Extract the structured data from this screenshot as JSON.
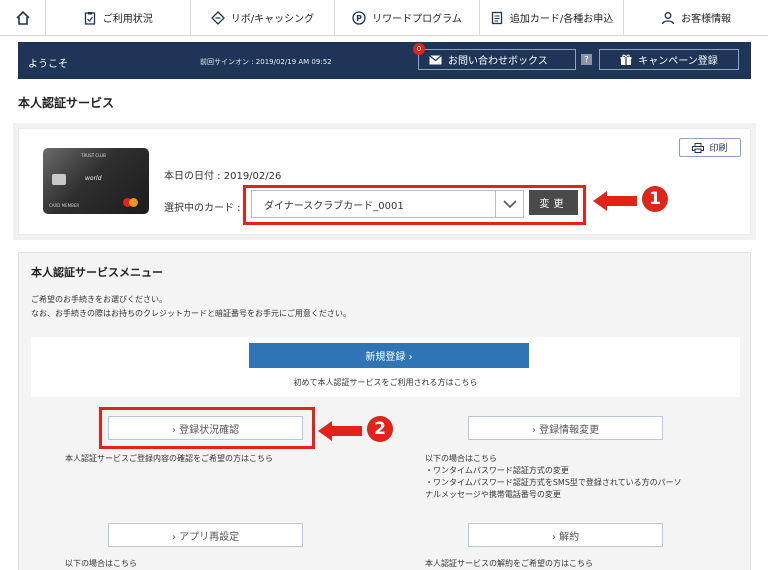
{
  "nav": {
    "items": [
      {
        "label": "ご利用状況",
        "icon": "clipboard-icon"
      },
      {
        "label": "リボ/キャッシング",
        "icon": "diamond-arrows-icon"
      },
      {
        "label": "リワードプログラム",
        "icon": "points-p-icon"
      },
      {
        "label": "追加カード/各種お申込",
        "icon": "document-icon"
      },
      {
        "label": "お客様情報",
        "icon": "person-icon"
      }
    ]
  },
  "welcome": {
    "greeting": "ようこそ",
    "last_signon": "前回サインオン : 2019/02/19 AM 09:52",
    "inbox_label": "お問い合わせボックス",
    "inbox_count": "0",
    "help_label": "?",
    "campaign_label": "キャンペーン登録"
  },
  "page_title": "本人認証サービス",
  "card_panel": {
    "card_brand_text": "TRUST CLUB",
    "card_world_text": "world",
    "card_member_text": "CARD MEMBER",
    "date_text": "本日の日付 : 2019/02/26",
    "select_label": "選択中のカード :",
    "selected_card": "ダイナースクラブカード_0001",
    "change_label": "変更",
    "print_label": "印刷"
  },
  "callouts": {
    "one": "1",
    "two": "2"
  },
  "menu": {
    "title": "本人認証サービスメニュー",
    "desc_line1": "ご希望のお手続きをお選びください。",
    "desc_line2": "なお、お手続きの際はお持ちのクレジットカードと暗証番号をお手元にご用意ください。",
    "new_label": "新規登録 ›",
    "new_note": "初めて本人認証サービスをご利用される方はこちら",
    "status_label": "› 登録状況確認",
    "status_desc": "本人認証サービスご登録内容の確認をご希望の方はこちら",
    "change_info_label": "› 登録情報変更",
    "change_info_desc1": "以下の場合はこちら",
    "change_info_desc2": "・ワンタイムパスワード認証方式の変更",
    "change_info_desc3": "・ワンタイムパスワード認証方式をSMS型で登録されている方のパーソ",
    "change_info_desc4": "ナルメッセージや携帯電話番号の変更",
    "app_label": "› アプリ再設定",
    "app_desc": "以下の場合はこちら",
    "cancel_label": "› 解約",
    "cancel_desc": "本人認証サービスの解約をご希望の方はこちら"
  }
}
